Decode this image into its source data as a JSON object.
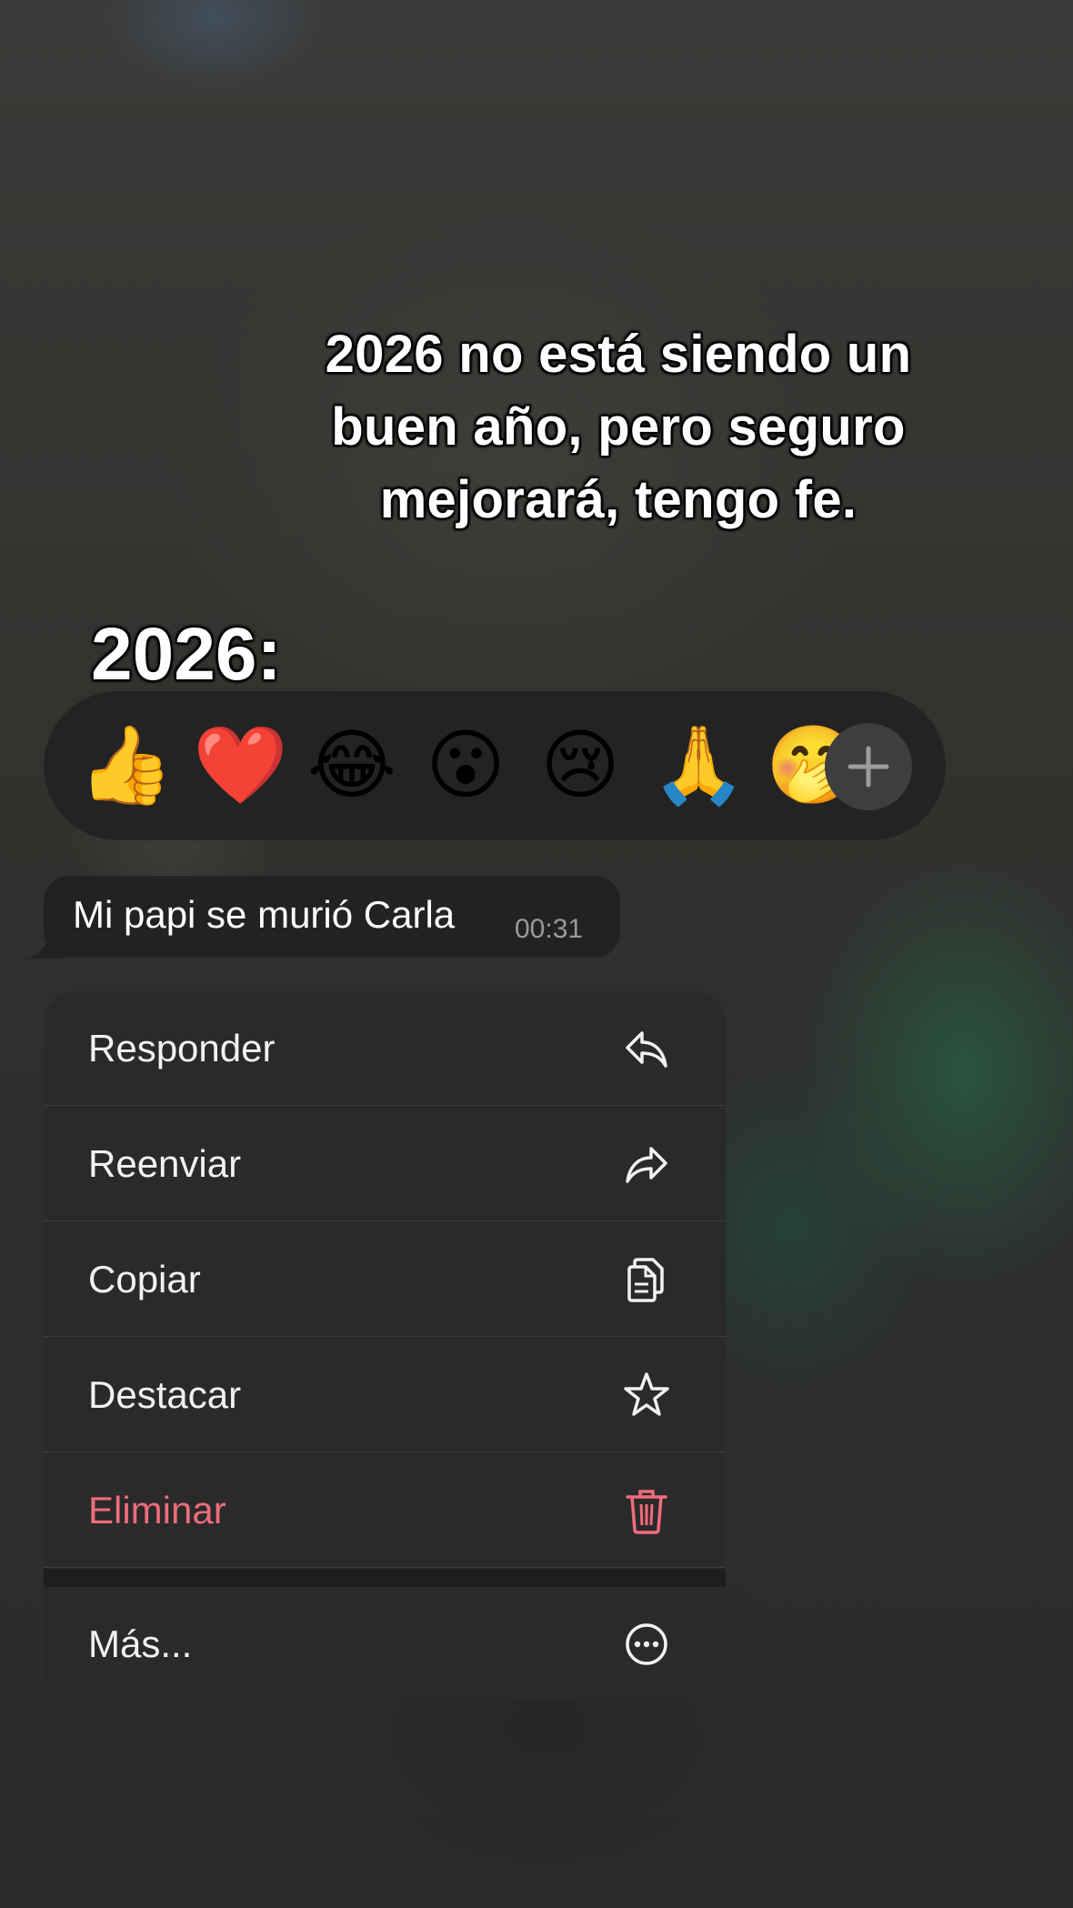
{
  "overlay": {
    "caption_lines": [
      "2026 no está siendo un",
      "buen año, pero seguro",
      "mejorará, tengo fe."
    ],
    "year_label": "2026:"
  },
  "reactions": {
    "emojis": [
      {
        "name": "thumbs-up",
        "glyph": "👍"
      },
      {
        "name": "red-heart",
        "glyph": "❤️"
      },
      {
        "name": "face-with-tears-of-joy",
        "glyph": "😂"
      },
      {
        "name": "face-with-open-mouth",
        "glyph": "😮"
      },
      {
        "name": "crying-face",
        "glyph": "😢"
      },
      {
        "name": "folded-hands",
        "glyph": "🙏"
      },
      {
        "name": "face-with-hand-over-mouth",
        "glyph": "🤭"
      }
    ],
    "add_icon": "plus-icon"
  },
  "message": {
    "text": "Mi papi se murió Carla",
    "time": "00:31"
  },
  "menu": {
    "items": [
      {
        "label": "Responder",
        "icon": "reply-icon"
      },
      {
        "label": "Reenviar",
        "icon": "forward-icon"
      },
      {
        "label": "Copiar",
        "icon": "copy-icon"
      },
      {
        "label": "Destacar",
        "icon": "star-icon"
      },
      {
        "label": "Eliminar",
        "icon": "trash-icon",
        "color": "#ef6c7a"
      },
      {
        "label": "Más...",
        "icon": "more-icon"
      }
    ]
  },
  "colors": {
    "danger": "#ef6c7a",
    "menu_bg": "#2a2a2a",
    "bubble_bg": "#222222"
  }
}
